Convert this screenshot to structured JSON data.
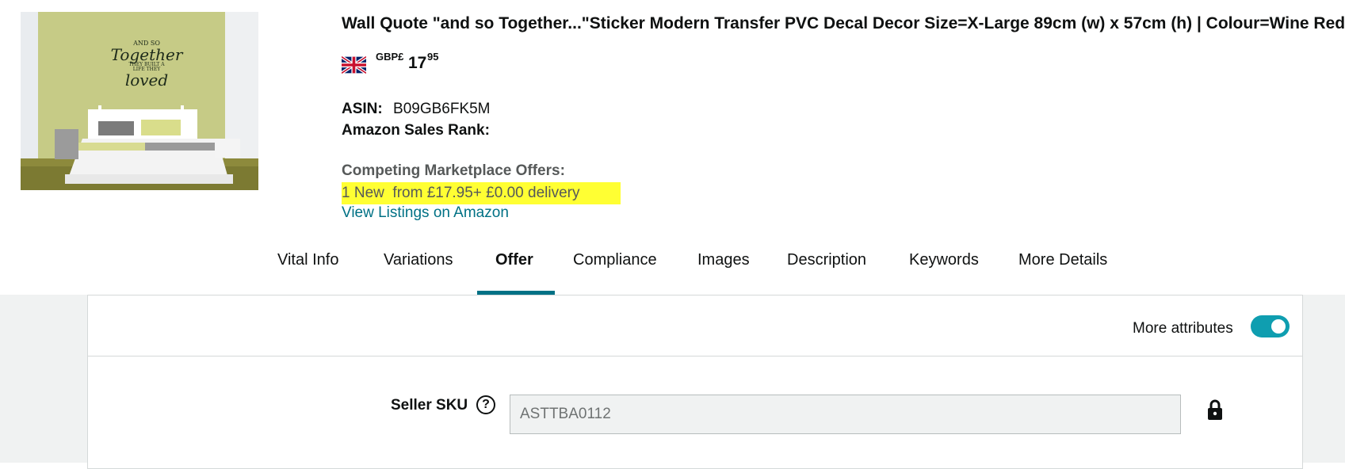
{
  "product": {
    "image_icon": "product-photo-bedroom-wall-decal",
    "image_text": [
      "AND SO",
      "Together",
      "THEY BUILT A",
      "LIFE THEY",
      "loved"
    ],
    "title": "Wall Quote \"and so Together...\"Sticker Modern Transfer PVC Decal Decor Size=X-Large 89cm (w) x 57cm (h) | Colour=Wine Red",
    "flag_icon": "uk-flag-icon",
    "price_currency": "GBP£",
    "price_whole": "17",
    "price_fraction": "95",
    "asin_label": "ASIN:",
    "asin_value": "B09GB6FK5M",
    "sales_rank_label": "Amazon Sales Rank:",
    "competing_label": "Competing Marketplace Offers:",
    "offers_text": "1 New  from £17.95+ £0.00 delivery",
    "view_listings": "View Listings on Amazon"
  },
  "tabs": [
    {
      "label": "Vital Info"
    },
    {
      "label": "Variations"
    },
    {
      "label": "Offer",
      "active": true
    },
    {
      "label": "Compliance"
    },
    {
      "label": "Images"
    },
    {
      "label": "Description"
    },
    {
      "label": "Keywords"
    },
    {
      "label": "More Details"
    }
  ],
  "offer_panel": {
    "more_attributes_label": "More attributes",
    "more_attributes_on": true,
    "seller_sku_label": "Seller SKU",
    "help_icon": "question-circle-icon",
    "seller_sku_value": "ASTTBA0112",
    "lock_icon": "lock-icon"
  },
  "colors": {
    "accent": "#007185",
    "toggle": "#0f9eb0",
    "highlight": "#ffff33",
    "gray_bg": "#f0f2f2"
  }
}
